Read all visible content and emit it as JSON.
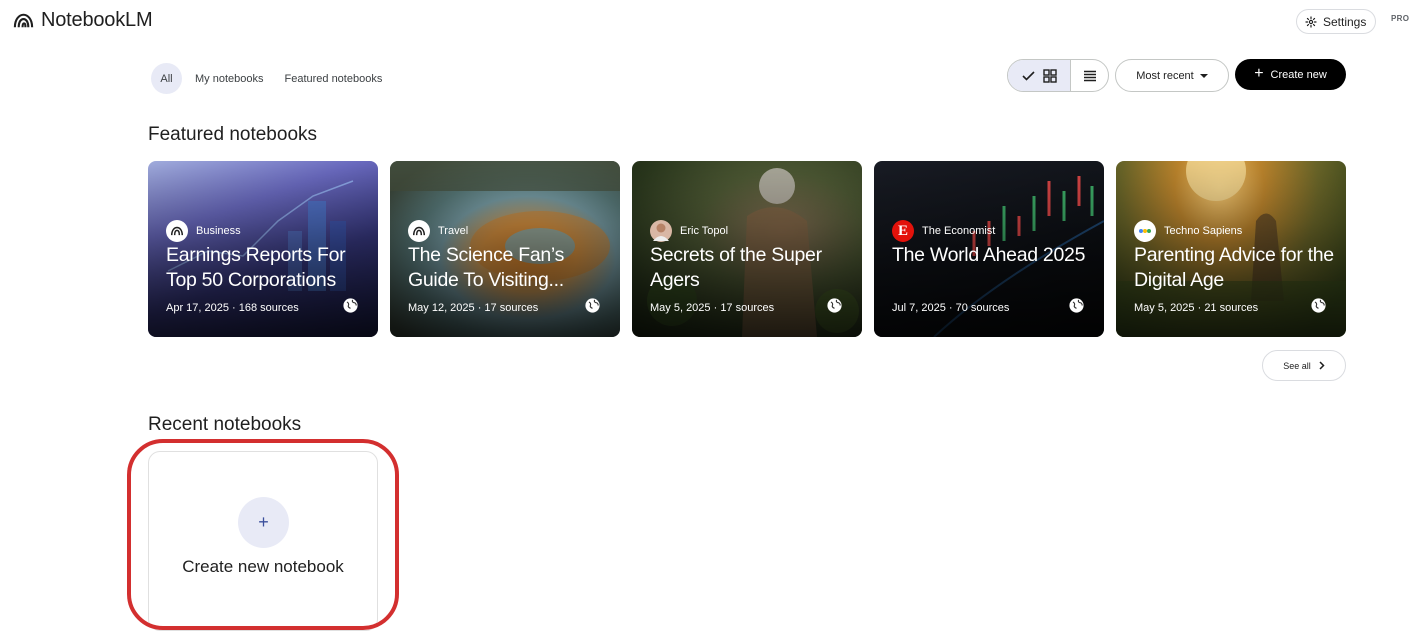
{
  "app": {
    "title": "NotebookLM"
  },
  "header": {
    "settings_label": "Settings",
    "pro_badge": "PRO"
  },
  "filters": {
    "tabs": [
      {
        "label": "All",
        "active": true
      },
      {
        "label": "My notebooks",
        "active": false
      },
      {
        "label": "Featured notebooks",
        "active": false
      }
    ]
  },
  "toolbar": {
    "view_selected": "grid",
    "sort_label": "Most recent",
    "create_label": "Create new"
  },
  "featured": {
    "heading": "Featured notebooks",
    "cards": [
      {
        "source": "Business",
        "title": "Earnings Reports For Top 50 Corporations",
        "meta": "Apr 17, 2025 · 168 sources",
        "source_icon": "notebooklm-logo-icon"
      },
      {
        "source": "Travel",
        "title": "The Science Fan’s Guide To Visiting...",
        "meta": "May 12, 2025 · 17 sources",
        "source_icon": "notebooklm-logo-icon"
      },
      {
        "source": "Eric Topol",
        "title": "Secrets of the Super Agers",
        "meta": "May 5, 2025 · 17 sources",
        "source_icon": "author-avatar-icon"
      },
      {
        "source": "The Economist",
        "title": "The World Ahead 2025",
        "meta": "Jul 7, 2025 · 70 sources",
        "source_icon": "economist-logo-icon"
      },
      {
        "source": "Techno Sapiens",
        "title": "Parenting Advice for the Digital Age",
        "meta": "May 5, 2025 · 21 sources",
        "source_icon": "techno-sapiens-logo-icon"
      }
    ],
    "see_all_label": "See all"
  },
  "recent": {
    "heading": "Recent notebooks",
    "create_tile_label": "Create new notebook",
    "create_tile_icon": "+"
  },
  "colors": {
    "accent_bg": "#e8eaf6",
    "primary_button": "#000000",
    "highlight_outline": "#d32f2f"
  }
}
